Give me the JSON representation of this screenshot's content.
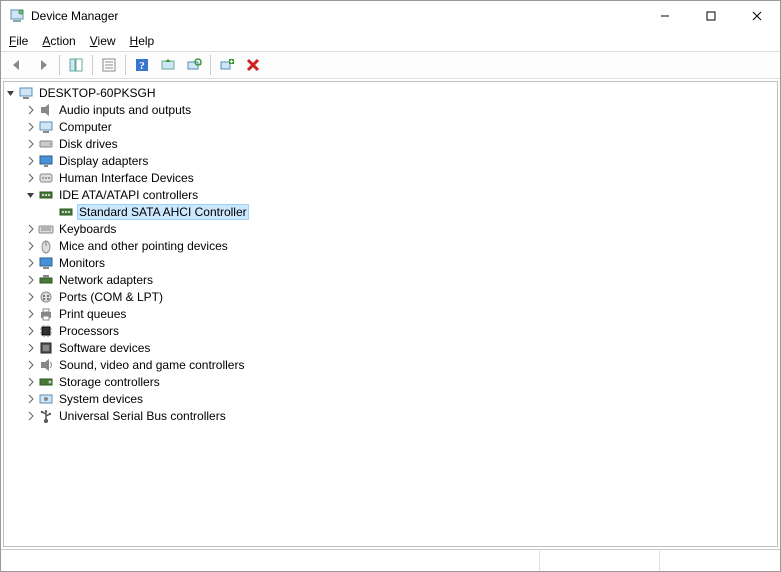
{
  "window": {
    "title": "Device Manager"
  },
  "menubar": {
    "file": "File",
    "action": "Action",
    "view": "View",
    "help": "Help"
  },
  "toolbar": {
    "back": "Back",
    "forward": "Forward",
    "show_hide": "Show/Hide Console Tree",
    "properties": "Properties",
    "help": "Help",
    "update_driver": "Update Driver",
    "scan": "Scan for hardware changes",
    "add_legacy": "Add legacy hardware",
    "uninstall": "Uninstall device"
  },
  "tree": {
    "root": "DESKTOP-60PKSGH",
    "nodes": [
      {
        "label": "Audio inputs and outputs",
        "icon": "audio"
      },
      {
        "label": "Computer",
        "icon": "computer"
      },
      {
        "label": "Disk drives",
        "icon": "disk"
      },
      {
        "label": "Display adapters",
        "icon": "display"
      },
      {
        "label": "Human Interface Devices",
        "icon": "hid"
      },
      {
        "label": "IDE ATA/ATAPI controllers",
        "icon": "ide",
        "expanded": true,
        "children": [
          {
            "label": "Standard SATA AHCI Controller",
            "icon": "ide",
            "selected": true
          }
        ]
      },
      {
        "label": "Keyboards",
        "icon": "keyboard"
      },
      {
        "label": "Mice and other pointing devices",
        "icon": "mouse"
      },
      {
        "label": "Monitors",
        "icon": "monitor"
      },
      {
        "label": "Network adapters",
        "icon": "network"
      },
      {
        "label": "Ports (COM & LPT)",
        "icon": "port"
      },
      {
        "label": "Print queues",
        "icon": "printer"
      },
      {
        "label": "Processors",
        "icon": "cpu"
      },
      {
        "label": "Software devices",
        "icon": "software"
      },
      {
        "label": "Sound, video and game controllers",
        "icon": "sound"
      },
      {
        "label": "Storage controllers",
        "icon": "storage"
      },
      {
        "label": "System devices",
        "icon": "system"
      },
      {
        "label": "Universal Serial Bus controllers",
        "icon": "usb"
      }
    ]
  }
}
